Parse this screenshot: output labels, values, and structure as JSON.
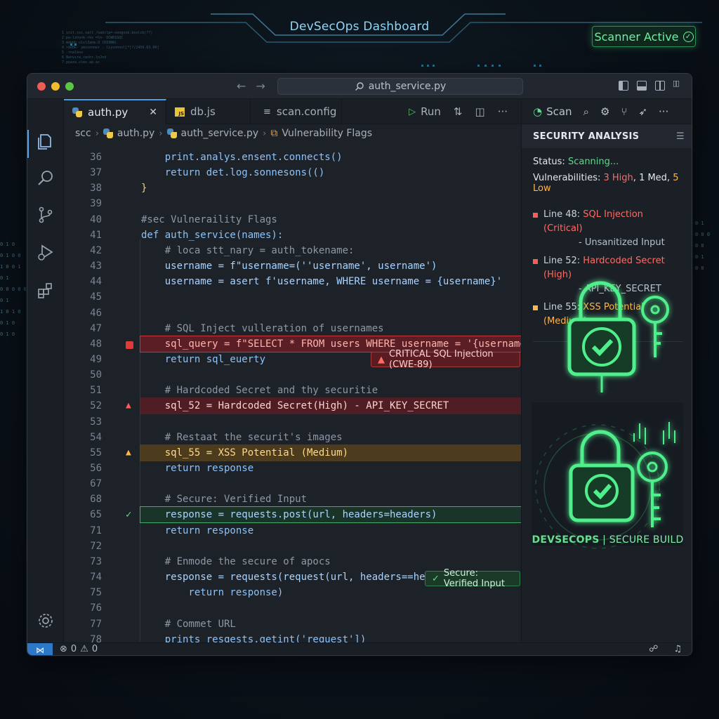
{
  "hud": {
    "title": "DevSecOps Dashboard",
    "scanner_status": "Scanner Active",
    "code_snippet": [
      "1  init.ssc.salt  /oabrlp=-nongoob.boolcb(??)",
      "2  pa-lzhsnk-rks  =ln-  OCWR1GQC",
      "3  mdpbh  ulslZane.O (DIORW)",
      "4  >dd0k-  ymzsnnner  -  liysnnnol[*[?/2459.63.00]",
      "5  -rnalkno",
      "6  Benvsre.cenhr.lnJnd",
      "7  ppaza.xlmx.ap.ac"
    ],
    "left_bits": [
      "0 1 0",
      "0 1 0 0",
      "1 0 0 1",
      "0 1",
      "0 0 0 0 0",
      "0 1",
      "1 0 1 0",
      "0 1 0",
      "0 1 0"
    ],
    "right_bits": [
      "0 1",
      "0 0 0",
      "0 0",
      "0 1",
      "0 0"
    ]
  },
  "window": {
    "search": "auth_service.py"
  },
  "tabs": [
    {
      "label": "auth.py",
      "icon": "python-icon",
      "active": true
    },
    {
      "label": "db.js",
      "icon": "javascript-icon",
      "active": false
    },
    {
      "label": "scan.config",
      "icon": "config-icon",
      "active": false
    }
  ],
  "tab_actions": {
    "run": "Run"
  },
  "breadcrumb": [
    "scc",
    "auth.py",
    "auth_service.py",
    "Vulnerability Flags"
  ],
  "code_lines": [
    {
      "n": "36",
      "text": "    print.analys.ensent.connects()"
    },
    {
      "n": "37",
      "text": "    return det.log.sonnesons(()"
    },
    {
      "n": "38",
      "text": "}"
    },
    {
      "n": "39",
      "text": ""
    },
    {
      "n": "40",
      "text": "#sec Vulneraility Flags"
    },
    {
      "n": "41",
      "text": "def auth_service(names):"
    },
    {
      "n": "42",
      "text": "    # loca stt_nary = auth_tokename:"
    },
    {
      "n": "43",
      "text": "    username = f\"username=(''username', username')"
    },
    {
      "n": "44",
      "text": "    username = asert f'username, WHERE username = {username}'"
    },
    {
      "n": "45",
      "text": ""
    },
    {
      "n": "46",
      "text": ""
    },
    {
      "n": "47",
      "text": "    # SQL Inject vulleration of usernames"
    },
    {
      "n": "48",
      "text": "    sql_query = f\"SELECT * FROM users WHERE username = '{username}'\""
    },
    {
      "n": "49",
      "text": "    return sql_euerty"
    },
    {
      "n": "50",
      "text": ""
    },
    {
      "n": "51",
      "text": "    # Hardcoded Secret and thy securitie"
    },
    {
      "n": "52",
      "text": "    sql_52 = Hardcoded Secret(High) - API_KEY_SECRET"
    },
    {
      "n": "53",
      "text": ""
    },
    {
      "n": "54",
      "text": "    # Restaat the securit's images"
    },
    {
      "n": "55",
      "text": "    sql_55 = XSS Potential (Medium)"
    },
    {
      "n": "56",
      "text": "    return response"
    },
    {
      "n": "67",
      "text": ""
    },
    {
      "n": "68",
      "text": "    # Secure: Verified Input"
    },
    {
      "n": "65",
      "text": "    response = requests.post(url, headers=headers)"
    },
    {
      "n": "71",
      "text": "    return response"
    },
    {
      "n": "72",
      "text": ""
    },
    {
      "n": "73",
      "text": "    # Enmode the secure of apocs"
    },
    {
      "n": "74",
      "text": "    response = requests(request(url, headers==headers):"
    },
    {
      "n": "75",
      "text": "        return response)"
    },
    {
      "n": "76",
      "text": ""
    },
    {
      "n": "77",
      "text": "    # Commet URL"
    },
    {
      "n": "78",
      "text": "    prints resqests.getint('request'])"
    }
  ],
  "inline_badges": {
    "critical": "CRITICAL  SQL Injection (CWE-89)",
    "secure": "Secure: Verified Input"
  },
  "panel": {
    "tools": {
      "scan": "Scan"
    },
    "header": "SECURITY ANALYSIS",
    "status_label": "Status:",
    "status_value": "Scanning...",
    "vuln_label": "Vulnerabilities:",
    "vuln_high": "3 High",
    "vuln_med": "1 Med",
    "vuln_low": "5 Low",
    "findings": [
      {
        "line": "Line 48:",
        "title": "SQL Injection (Critical)",
        "detail": "- Unsanitized Input",
        "color": "#ff5c55"
      },
      {
        "line": "Line 52:",
        "title": "Hardcoded Secret (High)",
        "detail": "- API_KEY_SECRET",
        "color": "#ff5c55"
      },
      {
        "line": "Line 55:",
        "title": "XSS Potential (Medium)",
        "detail": "",
        "color": "#ffb547"
      }
    ],
    "caption_bold": "DEVSECOPS",
    "caption_sep": " | ",
    "caption_thin": "SECURE BUILD"
  },
  "statusbar": {
    "errors": "0",
    "warnings": "0"
  },
  "colors": {
    "accent": "#4a9fe8",
    "critical": "#ff5c55",
    "medium": "#ffb547",
    "secure": "#62d88d"
  }
}
